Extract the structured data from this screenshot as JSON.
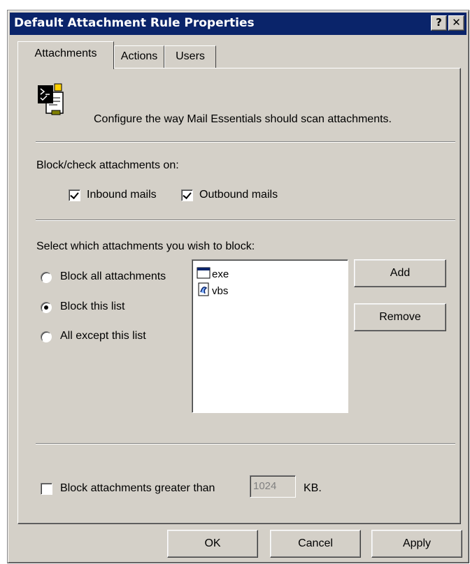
{
  "window": {
    "title": "Default Attachment Rule Properties",
    "help_label": "?",
    "close_label": "✕"
  },
  "tabs": [
    {
      "label": "Attachments",
      "active": true
    },
    {
      "label": "Actions",
      "active": false
    },
    {
      "label": "Users",
      "active": false
    }
  ],
  "header": {
    "icon": "attachment-config-icon",
    "description": "Configure the way Mail Essentials should scan attachments."
  },
  "block_check": {
    "label": "Block/check attachments on:",
    "inbound": {
      "label": "Inbound mails",
      "checked": true
    },
    "outbound": {
      "label": "Outbound mails",
      "checked": true
    }
  },
  "select_section": {
    "label": "Select which attachments you wish to block:",
    "options": [
      {
        "label": "Block all attachments",
        "selected": false
      },
      {
        "label": "Block this list",
        "selected": true
      },
      {
        "label": "All except this list",
        "selected": false
      }
    ],
    "list_items": [
      {
        "name": "exe",
        "icon": "exe-file-icon"
      },
      {
        "name": "vbs",
        "icon": "vbs-script-icon"
      }
    ],
    "add_label": "Add",
    "remove_label": "Remove"
  },
  "size_limit": {
    "label": "Block attachments greater than",
    "checked": false,
    "value": "1024",
    "unit": "KB."
  },
  "footer": {
    "ok_label": "OK",
    "cancel_label": "Cancel",
    "apply_label": "Apply"
  }
}
